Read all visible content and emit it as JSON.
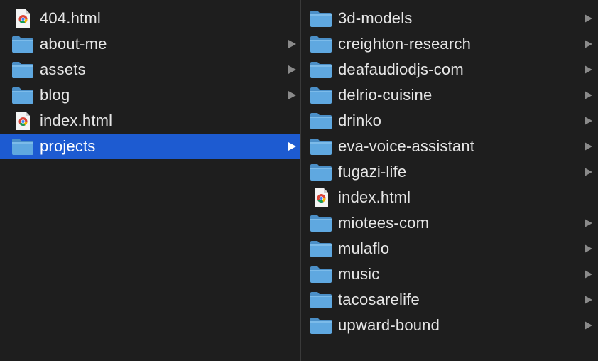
{
  "colors": {
    "background": "#1e1e1e",
    "selection": "#1d5bd1",
    "text": "#e6e6e6",
    "folder": "#5fa8e0",
    "chevron": "#8a8a8a"
  },
  "left_column": {
    "items": [
      {
        "name": "404.html",
        "icon": "chrome-html-file-icon",
        "expandable": false,
        "selected": false
      },
      {
        "name": "about-me",
        "icon": "folder-icon",
        "expandable": true,
        "selected": false
      },
      {
        "name": "assets",
        "icon": "folder-icon",
        "expandable": true,
        "selected": false
      },
      {
        "name": "blog",
        "icon": "folder-icon",
        "expandable": true,
        "selected": false
      },
      {
        "name": "index.html",
        "icon": "chrome-html-file-icon",
        "expandable": false,
        "selected": false
      },
      {
        "name": "projects",
        "icon": "folder-icon",
        "expandable": true,
        "selected": true
      }
    ]
  },
  "right_column": {
    "items": [
      {
        "name": "3d-models",
        "icon": "folder-icon",
        "expandable": true
      },
      {
        "name": "creighton-research",
        "icon": "folder-icon",
        "expandable": true
      },
      {
        "name": "deafaudiodjs-com",
        "icon": "folder-icon",
        "expandable": true
      },
      {
        "name": "delrio-cuisine",
        "icon": "folder-icon",
        "expandable": true
      },
      {
        "name": "drinko",
        "icon": "folder-icon",
        "expandable": true
      },
      {
        "name": "eva-voice-assistant",
        "icon": "folder-icon",
        "expandable": true
      },
      {
        "name": "fugazi-life",
        "icon": "folder-icon",
        "expandable": true
      },
      {
        "name": "index.html",
        "icon": "chrome-html-file-icon",
        "expandable": false
      },
      {
        "name": "miotees-com",
        "icon": "folder-icon",
        "expandable": true
      },
      {
        "name": "mulaflo",
        "icon": "folder-icon",
        "expandable": true
      },
      {
        "name": "music",
        "icon": "folder-icon",
        "expandable": true
      },
      {
        "name": "tacosarelife",
        "icon": "folder-icon",
        "expandable": true
      },
      {
        "name": "upward-bound",
        "icon": "folder-icon",
        "expandable": true
      }
    ]
  }
}
